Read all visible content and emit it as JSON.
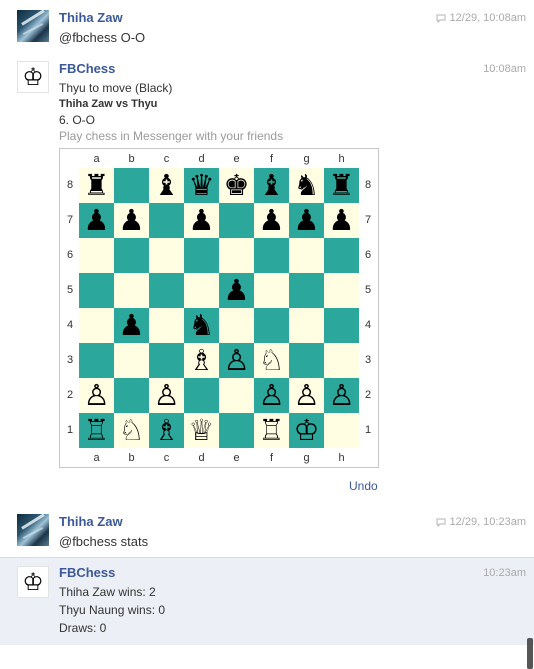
{
  "messages": [
    {
      "sender": "Thiha Zaw",
      "time": "12/29, 10:08am",
      "text": "@fbchess O-O"
    },
    {
      "sender": "FBChess",
      "time": "10:08am",
      "lines": [
        "Thyu to move (Black)",
        "Thiha Zaw vs Thyu",
        "6. O-O",
        "Play chess in Messenger with your friends"
      ]
    },
    {
      "sender": "Thiha Zaw",
      "time": "12/29, 10:23am",
      "text": "@fbchess stats"
    },
    {
      "sender": "FBChess",
      "time": "10:23am",
      "lines": [
        "Thiha Zaw wins: 2",
        "Thyu Naung wins: 0",
        "Draws: 0"
      ]
    }
  ],
  "board": {
    "files": [
      "a",
      "b",
      "c",
      "d",
      "e",
      "f",
      "g",
      "h"
    ],
    "ranks": [
      "8",
      "7",
      "6",
      "5",
      "4",
      "3",
      "2",
      "1"
    ],
    "rows": [
      [
        "♜",
        "",
        "♝",
        "♛",
        "♚",
        "♝",
        "♞",
        "♜"
      ],
      [
        "♟",
        "♟",
        "",
        "♟",
        "",
        "♟",
        "♟",
        "♟"
      ],
      [
        "",
        "",
        "",
        "",
        "",
        "",
        "",
        ""
      ],
      [
        "",
        "",
        "",
        "",
        "♟",
        "",
        "",
        ""
      ],
      [
        "",
        "♟",
        "",
        "♞",
        "",
        "",
        "",
        ""
      ],
      [
        "",
        "",
        "",
        "♗",
        "♙",
        "♘",
        "",
        ""
      ],
      [
        "♙",
        "",
        "♙",
        "",
        "",
        "♙",
        "♙",
        "♙"
      ],
      [
        "♖",
        "♘",
        "♗",
        "♕",
        "",
        "♖",
        "♔",
        ""
      ]
    ]
  },
  "undo_label": "Undo",
  "colors": {
    "link": "#3b5998",
    "dark_square": "#2ba89b",
    "light_square": "#fffde2"
  }
}
